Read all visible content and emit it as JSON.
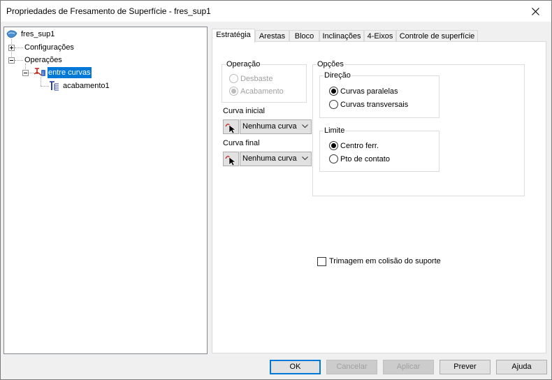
{
  "window": {
    "title": "Propriedades de Fresamento de Superfície - fres_sup1"
  },
  "tree": {
    "root": "fres_sup1",
    "configurations": "Configurações",
    "operations": "Operações",
    "operation_item": "entre curvas",
    "finishing_item": "acabamento1"
  },
  "tabs": [
    {
      "label": "Estratégia"
    },
    {
      "label": "Arestas"
    },
    {
      "label": "Bloco"
    },
    {
      "label": "Inclinações"
    },
    {
      "label": "4-Eixos"
    },
    {
      "label": "Controle de superfície"
    }
  ],
  "operation_group": {
    "legend": "Operação",
    "roughing": "Desbaste",
    "finishing": "Acabamento",
    "selected": "finishing",
    "enabled": false
  },
  "start_curve": {
    "label": "Curva inicial",
    "value": "Nenhuma curva"
  },
  "end_curve": {
    "label": "Curva final",
    "value": "Nenhuma curva"
  },
  "options_group": {
    "legend": "Opções",
    "direction": {
      "legend": "Direção",
      "parallel": "Curvas paralelas",
      "transverse": "Curvas transversais",
      "selected": "parallel"
    },
    "limit": {
      "legend": "Limite",
      "tool_center": "Centro ferr.",
      "contact_point": "Pto de contato",
      "selected": "tool_center"
    }
  },
  "trim_checkbox": {
    "label": "Trimagem em colisão do suporte",
    "checked": false
  },
  "buttons": {
    "ok": "OK",
    "cancel": "Cancelar",
    "apply": "Aplicar",
    "preview": "Prever",
    "help": "Ajuda"
  },
  "colors": {
    "selection": "#0078d7",
    "dialog_bg": "#f0f0f0",
    "disabled_text": "#a0a0a0"
  }
}
